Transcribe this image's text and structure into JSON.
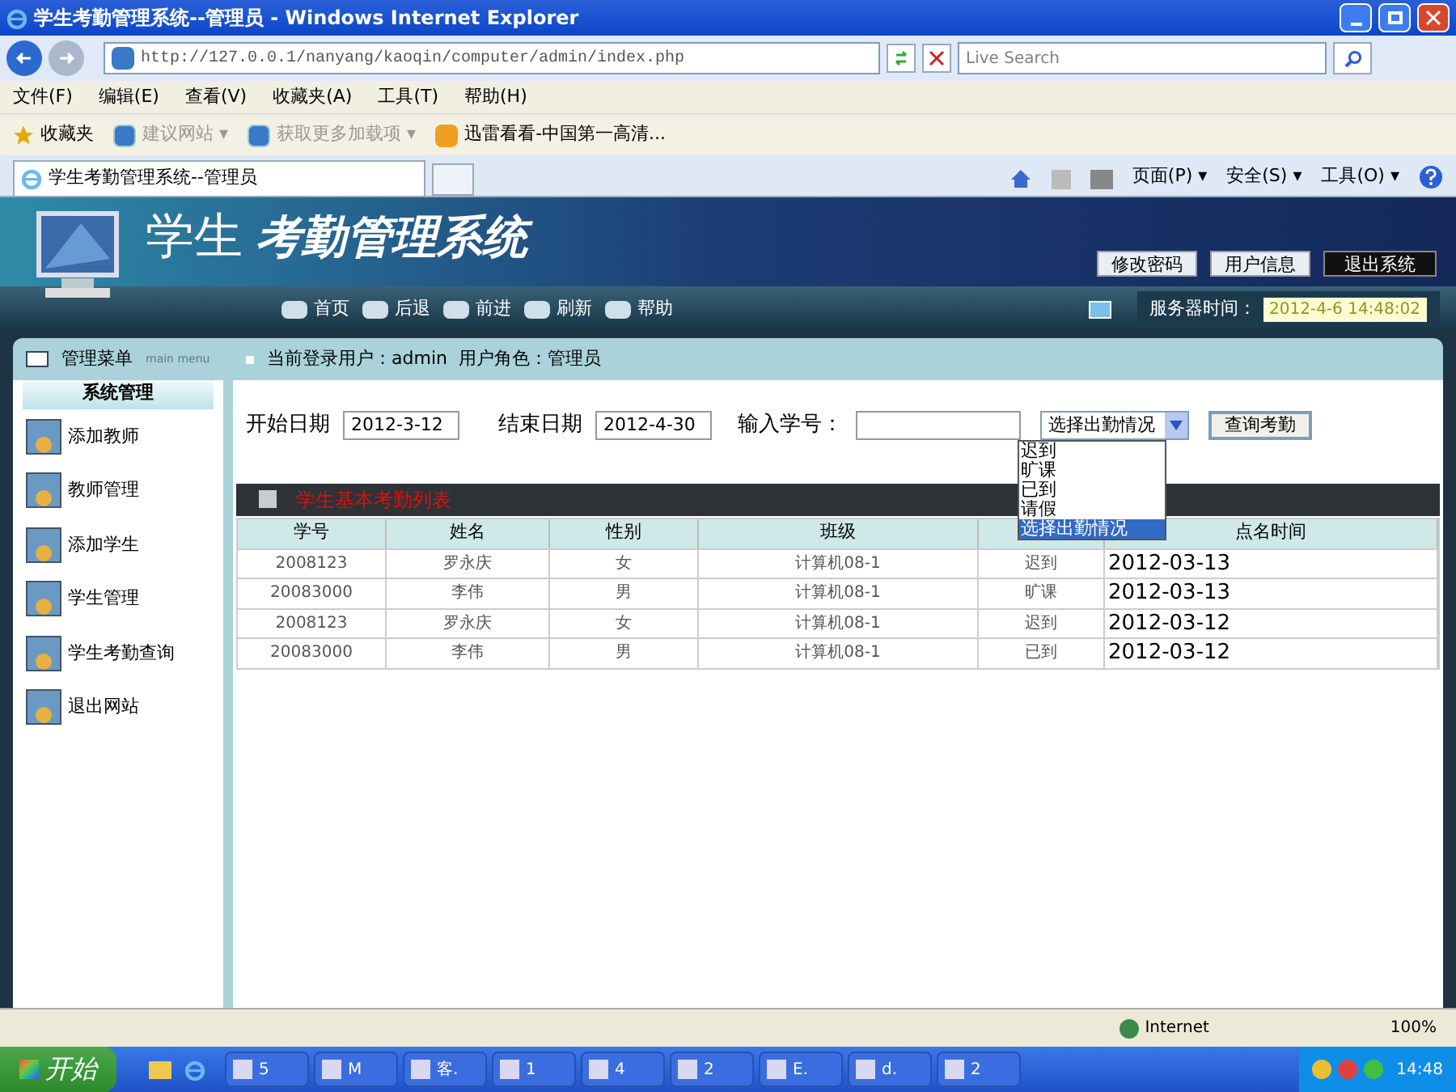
{
  "window": {
    "title": "学生考勤管理系统--管理员 - Windows Internet Explorer"
  },
  "address_bar": {
    "url": "http://127.0.0.1/nanyang/kaoqin/computer/admin/index.php"
  },
  "search": {
    "placeholder": "Live Search"
  },
  "menu_bar": [
    "文件(F)",
    "编辑(E)",
    "查看(V)",
    "收藏夹(A)",
    "工具(T)",
    "帮助(H)"
  ],
  "favorites_bar": [
    {
      "label": "收藏夹",
      "kind": "star"
    },
    {
      "label": "建议网站 ▾",
      "kind": "page"
    },
    {
      "label": "获取更多加载项 ▾",
      "kind": "page"
    },
    {
      "label": "迅雷看看-中国第一高清...",
      "kind": "media"
    }
  ],
  "tab": {
    "title": "学生考勤管理系统--管理员"
  },
  "command_bar": [
    "页面(P) ▾",
    "安全(S) ▾",
    "工具(O) ▾"
  ],
  "banner": {
    "title_plain": "学生",
    "title_bold": "考勤管理系统",
    "buttons": [
      {
        "label": "修改密码",
        "kind": "normal"
      },
      {
        "label": "用户信息",
        "kind": "normal"
      },
      {
        "label": "退出系统",
        "kind": "dark"
      }
    ]
  },
  "nav": [
    "首页",
    "后退",
    "前进",
    "刷新",
    "帮助"
  ],
  "server_time": {
    "label": "服务器时间：",
    "value": "2012-4-6 14:48:02"
  },
  "sidebar": {
    "title": "管理菜单",
    "subtitle": "main menu",
    "section": "系统管理",
    "items": [
      "添加教师",
      "教师管理",
      "添加学生",
      "学生管理",
      "学生考勤查询",
      "退出网站"
    ]
  },
  "user_info": "当前登录用户：admin  用户角色：管理员",
  "form": {
    "start_label": "开始日期",
    "start_value": "2012-3-12",
    "end_label": "结束日期",
    "end_value": "2012-4-30",
    "id_label": "输入学号：",
    "select_value": "选择出勤情况",
    "options": [
      {
        "label": "迟到",
        "selected": false
      },
      {
        "label": "旷课",
        "selected": false
      },
      {
        "label": "已到",
        "selected": false
      },
      {
        "label": "请假",
        "selected": false
      },
      {
        "label": "选择出勤情况",
        "selected": true
      }
    ],
    "query_button": "查询考勤"
  },
  "list_title": "学生基本考勤列表",
  "table": {
    "columns": [
      {
        "label": "学号"
      },
      {
        "label": "姓名"
      },
      {
        "label": "性别"
      },
      {
        "label": "班级"
      },
      {},
      {
        "label": "点名时间"
      }
    ],
    "rows": [
      [
        "2008123",
        "罗永庆",
        "女",
        "计算机08-1",
        "迟到",
        "2012-03-13"
      ],
      [
        "20083000",
        "李伟",
        "男",
        "计算机08-1",
        "旷课",
        "2012-03-13"
      ],
      [
        "2008123",
        "罗永庆",
        "女",
        "计算机08-1",
        "迟到",
        "2012-03-12"
      ],
      [
        "20083000",
        "李伟",
        "男",
        "计算机08-1",
        "已到",
        "2012-03-12"
      ]
    ]
  },
  "status_bar": {
    "zone": "Internet",
    "zoom": "100%"
  },
  "taskbar": {
    "start": "开始",
    "tasks": [
      "5",
      "M",
      "客.",
      "1",
      "4",
      "2",
      "E.",
      "d.",
      "2"
    ],
    "clock": "14:48"
  }
}
